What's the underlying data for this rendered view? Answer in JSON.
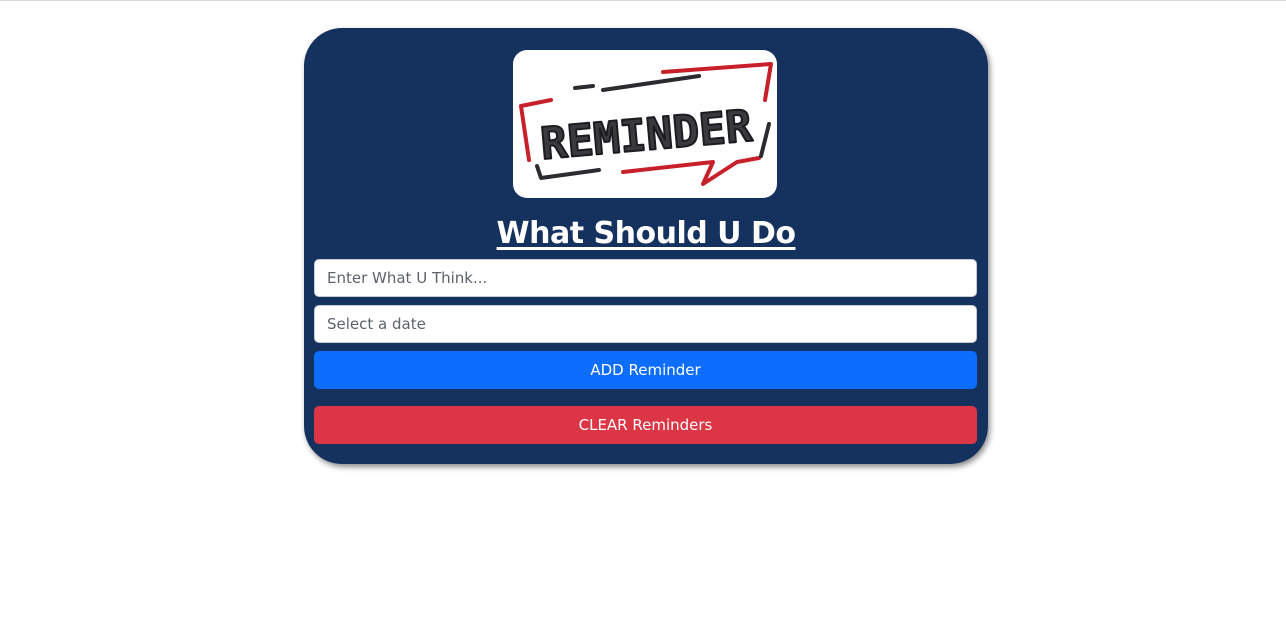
{
  "app": {
    "title": "What Should U Do",
    "logo_text": "REMINDER"
  },
  "form": {
    "task_placeholder": "Enter What U Think...",
    "task_value": "",
    "date_placeholder": "Select a date",
    "date_value": ""
  },
  "buttons": {
    "add_label": "ADD Reminder",
    "clear_label": "CLEAR Reminders"
  },
  "colors": {
    "card_background": "#15325f",
    "add_button": "#0d6efd",
    "clear_button": "#dc3545",
    "logo_accent_red": "#c8202b",
    "logo_accent_dark": "#2b2b30"
  }
}
